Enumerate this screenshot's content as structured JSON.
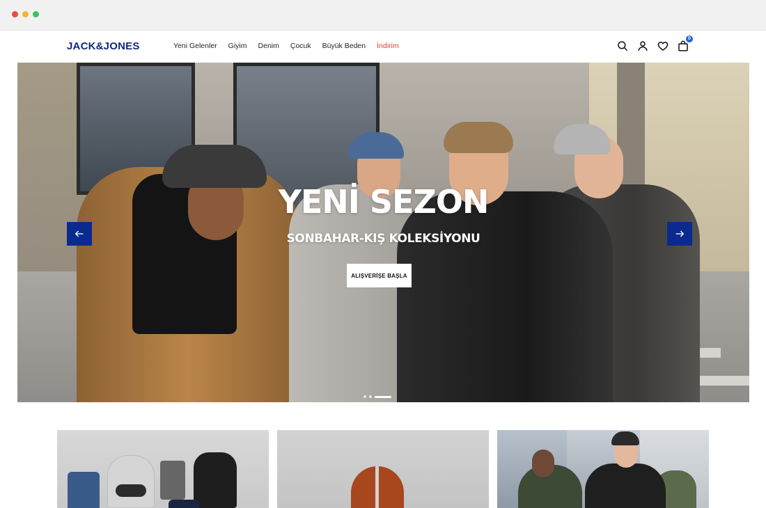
{
  "brand": {
    "logo_text": "JACK&JONES",
    "accent": "#0f2a7a",
    "sale_color": "#e63b2e"
  },
  "nav": {
    "items": [
      {
        "label": "Yeni Gelenler"
      },
      {
        "label": "Giyim"
      },
      {
        "label": "Denim"
      },
      {
        "label": "Çocuk"
      },
      {
        "label": "Büyük Beden"
      },
      {
        "label": "İndirim"
      }
    ]
  },
  "header_icons": {
    "search": "search-icon",
    "account": "user-icon",
    "wishlist": "heart-icon",
    "cart": "shopping-bag-icon",
    "cart_count": "0"
  },
  "hero": {
    "title": "YENİ SEZON",
    "subtitle": "SONBAHAR-KIŞ KOLEKSİYONU",
    "cta_label": "ALIŞVERİŞE BAŞLA",
    "arrow_color": "#0b2a8f",
    "slides_total": 3,
    "active_slide": 3
  },
  "categories": [
    {
      "image": "product-flatlay"
    },
    {
      "image": "orange-hoodie"
    },
    {
      "image": "winter-jackets-street"
    }
  ]
}
